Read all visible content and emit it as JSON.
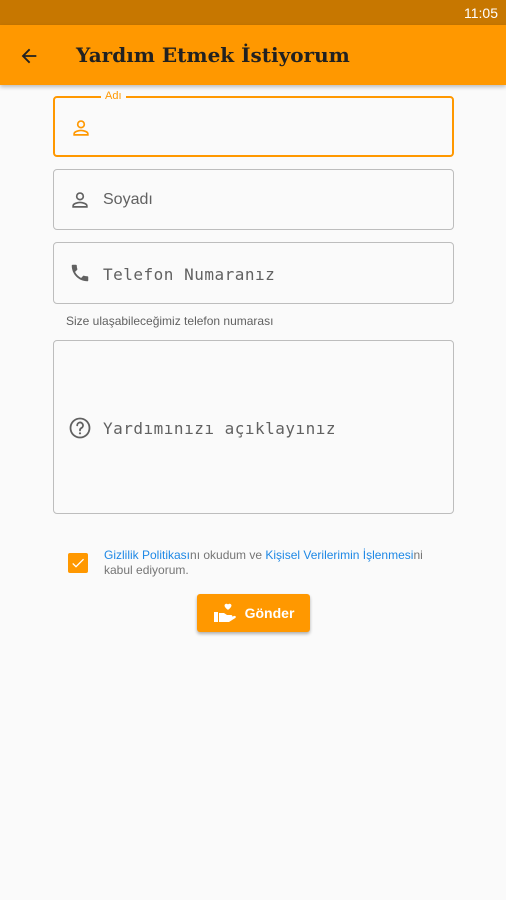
{
  "status_bar": {
    "time": "11:05"
  },
  "app_bar": {
    "title": "Yardım Etmek İstiyorum",
    "back_icon": "arrow-left-icon"
  },
  "form": {
    "first_name": {
      "label": "Adı",
      "value": "",
      "icon": "person-icon"
    },
    "last_name": {
      "placeholder": "Soyadı",
      "value": "",
      "icon": "person-icon"
    },
    "phone": {
      "placeholder": "Telefon Numaranız",
      "value": "",
      "icon": "phone-icon",
      "helper": "Size ulaşabileceğimiz telefon numarası"
    },
    "description": {
      "placeholder": "Yardımınızı açıklayınız",
      "value": "",
      "icon": "help-circle-icon"
    }
  },
  "consent": {
    "checked": true,
    "privacy_link": "Gizlilik Politikası",
    "text_mid": "nı okudum ve ",
    "data_link": "Kişisel Verilerimin İşlenmesi",
    "text_end": "ni kabul ediyorum."
  },
  "submit": {
    "label": "Gönder",
    "icon": "helping-hand-icon"
  },
  "colors": {
    "primary": "#ff9800",
    "status_bar": "#c77700",
    "link": "#1e88e5"
  }
}
